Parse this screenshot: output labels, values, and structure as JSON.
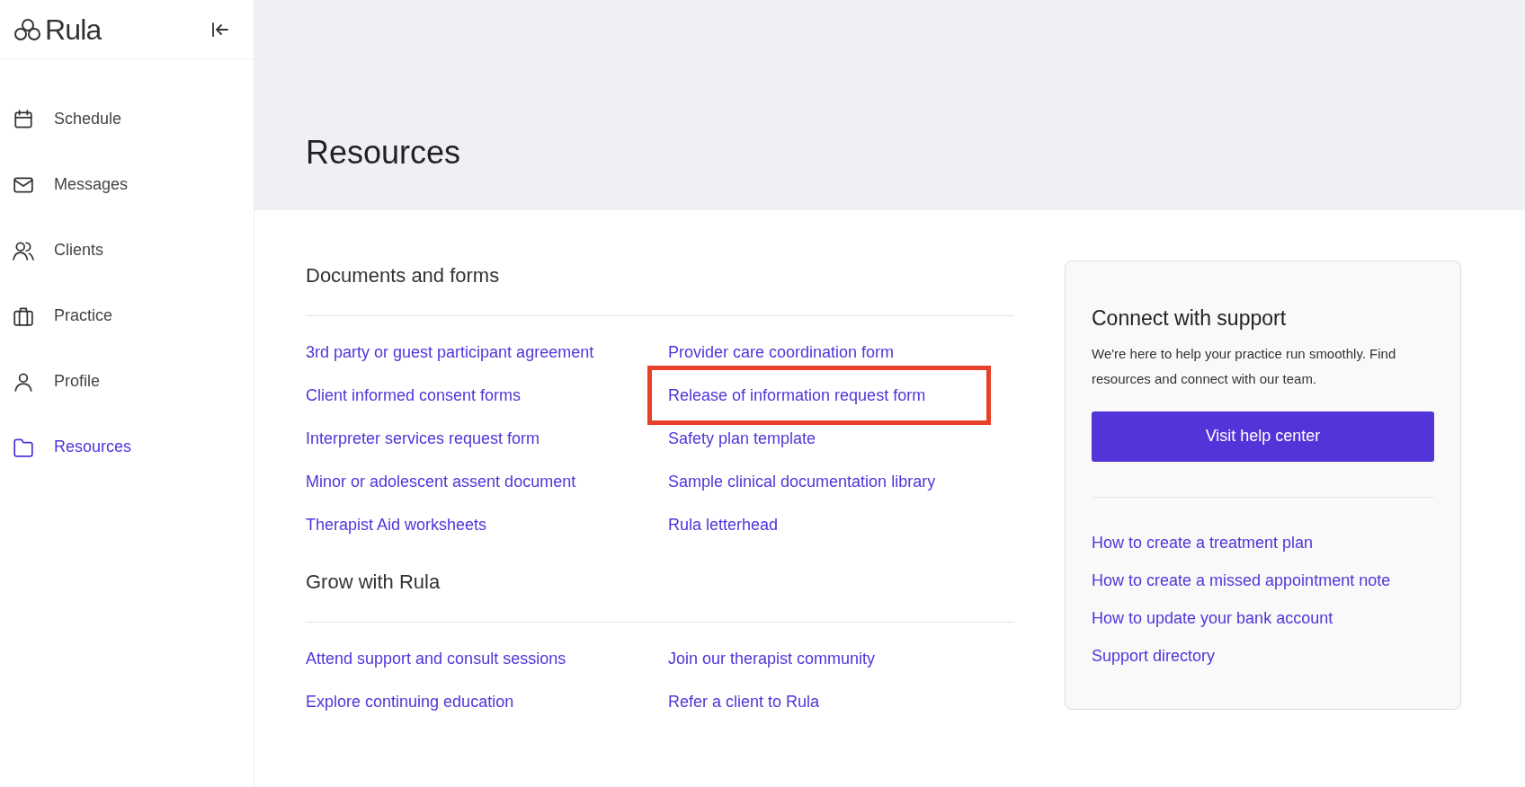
{
  "logo": {
    "text": "Rula"
  },
  "sidebar": {
    "items": [
      {
        "label": "Schedule",
        "selected": false
      },
      {
        "label": "Messages",
        "selected": false
      },
      {
        "label": "Clients",
        "selected": false
      },
      {
        "label": "Practice",
        "selected": false
      },
      {
        "label": "Profile",
        "selected": false
      },
      {
        "label": "Resources",
        "selected": true
      }
    ]
  },
  "page_title": "Resources",
  "sections": [
    {
      "title": "Documents and forms",
      "links": [
        {
          "text": "3rd party or guest participant agreement",
          "highlighted": false
        },
        {
          "text": "Provider care coordination form",
          "highlighted": false
        },
        {
          "text": "Client informed consent forms",
          "highlighted": false
        },
        {
          "text": "Release of information request form",
          "highlighted": true
        },
        {
          "text": "Interpreter services request form",
          "highlighted": false
        },
        {
          "text": "Safety plan template",
          "highlighted": false
        },
        {
          "text": "Minor or adolescent assent document",
          "highlighted": false
        },
        {
          "text": "Sample clinical documentation library",
          "highlighted": false
        },
        {
          "text": "Therapist Aid worksheets",
          "highlighted": false
        },
        {
          "text": "Rula letterhead",
          "highlighted": false
        }
      ]
    },
    {
      "title": "Grow with Rula",
      "links": [
        {
          "text": "Attend support and consult sessions",
          "highlighted": false
        },
        {
          "text": "Join our therapist community",
          "highlighted": false
        },
        {
          "text": "Explore continuing education",
          "highlighted": false
        },
        {
          "text": "Refer a client to Rula",
          "highlighted": false
        }
      ]
    }
  ],
  "support_card": {
    "title": "Connect with support",
    "description": "We're here to help your practice run smoothly. Find resources and connect with our team.",
    "button": "Visit help center",
    "links": [
      "How to create a treatment plan",
      "How to create a missed appointment note",
      "How to update your bank account",
      "Support directory"
    ]
  }
}
